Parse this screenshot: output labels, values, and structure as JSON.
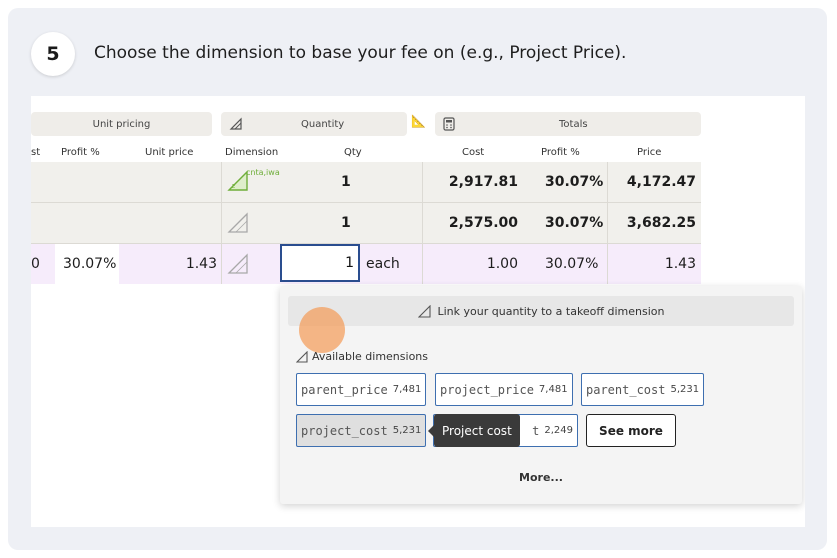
{
  "step": {
    "number": "5",
    "instruction": "Choose the dimension to base your fee on (e.g., Project Price)."
  },
  "groups": {
    "unit_pricing": "Unit pricing",
    "quantity": "Quantity",
    "totals": "Totals"
  },
  "columns": {
    "cost_trunc": "st",
    "profit": "Profit %",
    "unit_price": "Unit price",
    "dimension": "Dimension",
    "qty": "Qty",
    "cost": "Cost",
    "profit2": "Profit %",
    "price": "Price"
  },
  "rows": [
    {
      "dimension_tag": "cnta,iwa",
      "qty": "1",
      "cost": "2,917.81",
      "profit": "30.07%",
      "price": "4,172.47"
    },
    {
      "qty": "1",
      "cost": "2,575.00",
      "profit": "30.07%",
      "price": "3,682.25"
    },
    {
      "left_trunc": "0",
      "profit_left": "30.07%",
      "unit_price": "1.43",
      "qty": "1",
      "unit": "each",
      "cost": "1.00",
      "profit": "30.07%",
      "price": "1.43"
    }
  ],
  "popup": {
    "link_label": "Link your quantity to a takeoff dimension",
    "available_label": "Available dimensions",
    "chips": [
      {
        "name": "parent_price",
        "value": "7,481"
      },
      {
        "name": "project_price",
        "value": "7,481"
      },
      {
        "name": "parent_cost",
        "value": "5,231"
      },
      {
        "name": "project_cost",
        "value": "5,231"
      },
      {
        "name": "t",
        "value": "2,249"
      }
    ],
    "see_more": "See more",
    "tooltip": "Project cost",
    "more": "More..."
  },
  "colors": {
    "chip_border": "#3e6fb0",
    "input_border": "#2a4d8f",
    "purple_row": "#f6ecfb",
    "green_icon": "#6fae3a"
  }
}
